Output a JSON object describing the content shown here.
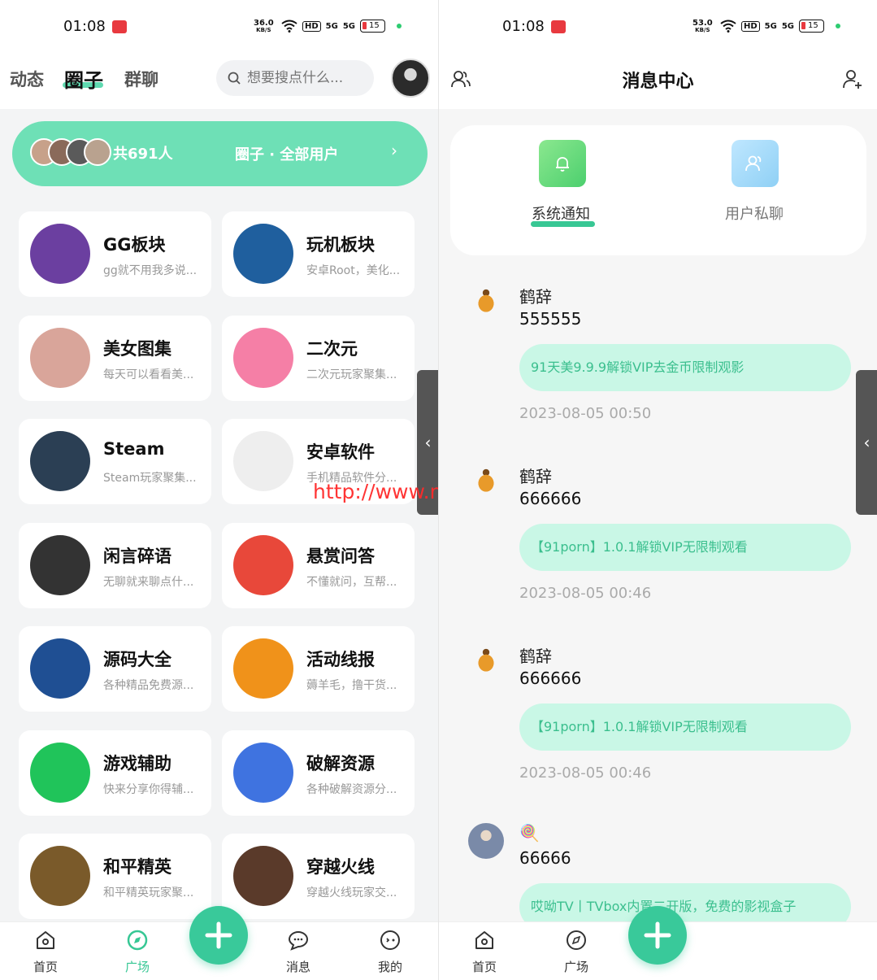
{
  "left": {
    "status": {
      "time": "01:08",
      "speed_value": "36.0",
      "speed_unit": "KB/S",
      "hd": "HD",
      "sig1": "5G",
      "sig2": "5G",
      "battery": "15"
    },
    "tabs": [
      {
        "label": "动态"
      },
      {
        "label": "圈子"
      },
      {
        "label": "群聊"
      }
    ],
    "search_placeholder": "想要搜点什么...",
    "banner": {
      "count": "共691人",
      "title": "圈子 · 全部用户"
    },
    "cards": [
      {
        "name": "GG板块",
        "desc": "gg就不用我多说...",
        "icon": "gg-icon",
        "color": "#6b3fa0"
      },
      {
        "name": "玩机板块",
        "desc": "安卓Root，美化...",
        "icon": "gamepad-blue-icon",
        "color": "#1f5f9e"
      },
      {
        "name": "美女图集",
        "desc": "每天可以看看美...",
        "icon": "girl-photo-icon",
        "color": "#d9a59a"
      },
      {
        "name": "二次元",
        "desc": "二次元玩家聚集...",
        "icon": "bilibili-tv-icon",
        "color": "#f57fa6"
      },
      {
        "name": "Steam",
        "desc": "Steam玩家聚集...",
        "icon": "steam-icon",
        "color": "#2b3f54"
      },
      {
        "name": "安卓软件",
        "desc": "手机精品软件分...",
        "icon": "android-icon",
        "color": "#eeeeee"
      },
      {
        "name": "闲言碎语",
        "desc": "无聊就来聊点什...",
        "icon": "panda-meme-icon",
        "color": "#333333"
      },
      {
        "name": "悬赏问答",
        "desc": "不懂就问，互帮...",
        "icon": "reward-icon",
        "color": "#e8483a"
      },
      {
        "name": "源码大全",
        "desc": "各种精品免费源...",
        "icon": "html5-icon",
        "color": "#1f4f93"
      },
      {
        "name": "活动线报",
        "desc": "薅羊毛，撸干货...",
        "icon": "badge-check-icon",
        "color": "#f0921a"
      },
      {
        "name": "游戏辅助",
        "desc": "快来分享你得辅...",
        "icon": "gamepad-green-icon",
        "color": "#20c45a"
      },
      {
        "name": "破解资源",
        "desc": "各种破解资源分...",
        "icon": "lock-icon",
        "color": "#3f73e0"
      },
      {
        "name": "和平精英",
        "desc": "和平精英玩家聚...",
        "icon": "pubg-icon",
        "color": "#7a5a2a"
      },
      {
        "name": "穿越火线",
        "desc": "穿越火线玩家交...",
        "icon": "crossfire-icon",
        "color": "#5a3a2a"
      }
    ],
    "nav": [
      {
        "label": "首页"
      },
      {
        "label": "广场"
      },
      {
        "label": "消息"
      },
      {
        "label": "我的"
      }
    ],
    "watermark": "http://www.miyuanma.com"
  },
  "right": {
    "status": {
      "time": "01:08",
      "speed_value": "53.0",
      "speed_unit": "KB/S",
      "hd": "HD",
      "sig1": "5G",
      "sig2": "5G",
      "battery": "15"
    },
    "title": "消息中心",
    "tabs": [
      {
        "label": "系统通知"
      },
      {
        "label": "用户私聊"
      }
    ],
    "messages": [
      {
        "user": "鹤辞",
        "content": "555555",
        "quote": "91天美9.9.9解锁VIP去金币限制观影",
        "time": "2023-08-05 00:50"
      },
      {
        "user": "鹤辞",
        "content": "666666",
        "quote": "【91porn】1.0.1解锁VIP无限制观看",
        "time": "2023-08-05 00:46"
      },
      {
        "user": "鹤辞",
        "content": "666666",
        "quote": "【91porn】1.0.1解锁VIP无限制观看",
        "time": "2023-08-05 00:46"
      },
      {
        "user": "🍭",
        "content": "66666",
        "quote": "哎呦TV丨TVbox内置二开版，免费的影视盒子",
        "time": ""
      }
    ],
    "nav": [
      {
        "label": "首页"
      },
      {
        "label": "广场"
      }
    ]
  },
  "colors": {
    "accent": "#39c99a",
    "banner": "#6ee0b6",
    "quote_bg": "#c9f7e6"
  }
}
